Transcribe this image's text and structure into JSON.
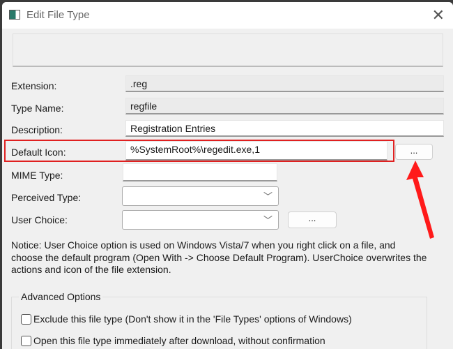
{
  "window": {
    "title": "Edit File Type"
  },
  "fields": {
    "extension": {
      "label": "Extension:",
      "value": ".reg"
    },
    "type_name": {
      "label": "Type Name:",
      "value": "regfile"
    },
    "description": {
      "label": "Description:",
      "value": "Registration Entries"
    },
    "default_icon": {
      "label": "Default Icon:",
      "value": "%SystemRoot%\\regedit.exe,1"
    },
    "mime_type": {
      "label": "MIME Type:",
      "value": ""
    },
    "perceived_type": {
      "label": "Perceived Type:",
      "value": ""
    },
    "user_choice": {
      "label": "User Choice:",
      "value": ""
    }
  },
  "browse_label": "...",
  "notice": "Notice: User Choice option is used on Windows Vista/7 when you right click on a file, and choose the default program (Open With -> Choose Default Program). UserChoice overwrites the actions and icon of the file extension.",
  "advanced": {
    "title": "Advanced Options",
    "options": [
      {
        "label": "Exclude  this file type (Don't show it in the 'File Types' options of Windows)",
        "checked": false
      },
      {
        "label": "Open this file type immediately after download, without confirmation",
        "checked": false
      }
    ]
  },
  "colors": {
    "highlight": "#e02020",
    "arrow": "#ff1a1a"
  }
}
